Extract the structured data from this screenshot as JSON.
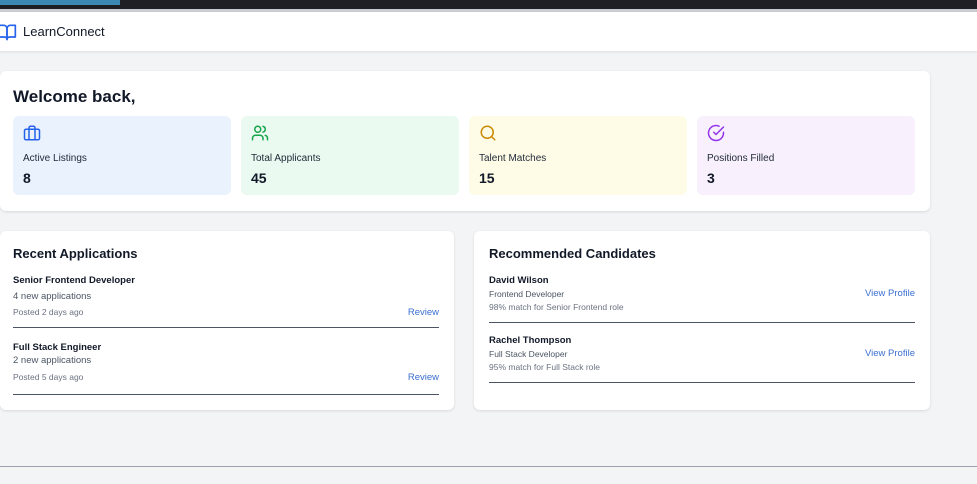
{
  "app": {
    "name": "LearnConnect"
  },
  "welcome": {
    "title": "Welcome back,"
  },
  "stats": [
    {
      "label": "Active Listings",
      "value": "8",
      "icon": "briefcase-icon",
      "bg": "#eaf2fe",
      "icon_color": "#2563eb"
    },
    {
      "label": "Total Applicants",
      "value": "45",
      "icon": "users-icon",
      "bg": "#eafaf0",
      "icon_color": "#16a34a"
    },
    {
      "label": "Talent Matches",
      "value": "15",
      "icon": "search-icon",
      "bg": "#fefbe6",
      "icon_color": "#ca8a04"
    },
    {
      "label": "Positions Filled",
      "value": "3",
      "icon": "check-circle-icon",
      "bg": "#f8f0fd",
      "icon_color": "#9333ea"
    }
  ],
  "recent_applications": {
    "title": "Recent Applications",
    "items": [
      {
        "title": "Senior Frontend Developer",
        "count": "4 new applications",
        "posted": "Posted 2 days ago",
        "action": "Review"
      },
      {
        "title": "Full Stack Engineer",
        "count": "2 new applications",
        "posted": "Posted 5 days ago",
        "action": "Review"
      }
    ]
  },
  "recommended_candidates": {
    "title": "Recommended Candidates",
    "items": [
      {
        "name": "David Wilson",
        "role": "Frontend Developer",
        "match": "98% match for Senior Frontend role",
        "action": "View Profile"
      },
      {
        "name": "Rachel Thompson",
        "role": "Full Stack Developer",
        "match": "95% match for Full Stack role",
        "action": "View Profile"
      }
    ]
  },
  "colors": {
    "accent": "#3b6fd1",
    "brand": "#2563eb"
  }
}
